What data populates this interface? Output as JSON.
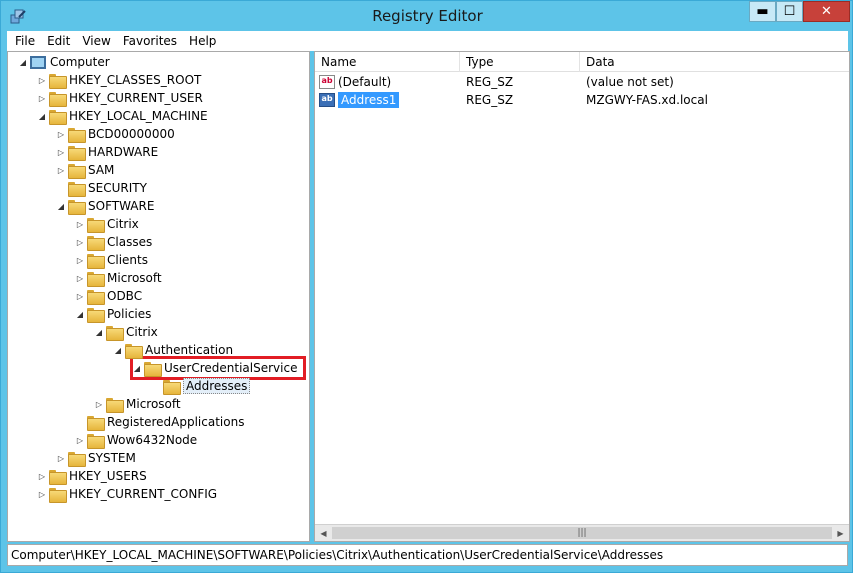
{
  "window": {
    "title": "Registry Editor",
    "controls": {
      "minimize": "▬",
      "maximize": "☐",
      "close": "✕"
    }
  },
  "menu": [
    "File",
    "Edit",
    "View",
    "Favorites",
    "Help"
  ],
  "tree": [
    {
      "label": "Computer",
      "depth": 0,
      "expander": "◢",
      "icon": "computer-icon"
    },
    {
      "label": "HKEY_CLASSES_ROOT",
      "depth": 1,
      "expander": "▷",
      "icon": "folder-icon"
    },
    {
      "label": "HKEY_CURRENT_USER",
      "depth": 1,
      "expander": "▷",
      "icon": "folder-icon"
    },
    {
      "label": "HKEY_LOCAL_MACHINE",
      "depth": 1,
      "expander": "◢",
      "icon": "folder-icon"
    },
    {
      "label": "BCD00000000",
      "depth": 2,
      "expander": "▷",
      "icon": "folder-icon"
    },
    {
      "label": "HARDWARE",
      "depth": 2,
      "expander": "▷",
      "icon": "folder-icon"
    },
    {
      "label": "SAM",
      "depth": 2,
      "expander": "▷",
      "icon": "folder-icon"
    },
    {
      "label": "SECURITY",
      "depth": 2,
      "expander": "",
      "icon": "folder-icon"
    },
    {
      "label": "SOFTWARE",
      "depth": 2,
      "expander": "◢",
      "icon": "folder-icon"
    },
    {
      "label": "Citrix",
      "depth": 3,
      "expander": "▷",
      "icon": "folder-icon"
    },
    {
      "label": "Classes",
      "depth": 3,
      "expander": "▷",
      "icon": "folder-icon"
    },
    {
      "label": "Clients",
      "depth": 3,
      "expander": "▷",
      "icon": "folder-icon"
    },
    {
      "label": "Microsoft",
      "depth": 3,
      "expander": "▷",
      "icon": "folder-icon"
    },
    {
      "label": "ODBC",
      "depth": 3,
      "expander": "▷",
      "icon": "folder-icon"
    },
    {
      "label": "Policies",
      "depth": 3,
      "expander": "◢",
      "icon": "folder-icon"
    },
    {
      "label": "Citrix",
      "depth": 4,
      "expander": "◢",
      "icon": "folder-icon"
    },
    {
      "label": "Authentication",
      "depth": 5,
      "expander": "◢",
      "icon": "folder-icon"
    },
    {
      "label": "UserCredentialService",
      "depth": 6,
      "expander": "◢",
      "icon": "folder-icon"
    },
    {
      "label": "Addresses",
      "depth": 7,
      "expander": "",
      "icon": "folder-icon",
      "selected": true
    },
    {
      "label": "Microsoft",
      "depth": 4,
      "expander": "▷",
      "icon": "folder-icon"
    },
    {
      "label": "RegisteredApplications",
      "depth": 3,
      "expander": "",
      "icon": "folder-icon"
    },
    {
      "label": "Wow6432Node",
      "depth": 3,
      "expander": "▷",
      "icon": "folder-icon"
    },
    {
      "label": "SYSTEM",
      "depth": 2,
      "expander": "▷",
      "icon": "folder-icon"
    },
    {
      "label": "HKEY_USERS",
      "depth": 1,
      "expander": "▷",
      "icon": "folder-icon"
    },
    {
      "label": "HKEY_CURRENT_CONFIG",
      "depth": 1,
      "expander": "▷",
      "icon": "folder-icon"
    }
  ],
  "list": {
    "columns": [
      "Name",
      "Type",
      "Data"
    ],
    "rows": [
      {
        "name": "(Default)",
        "type": "REG_SZ",
        "data": "(value not set)",
        "selected": false
      },
      {
        "name": "Address1",
        "type": "REG_SZ",
        "data": "MZGWY-FAS.xd.local",
        "selected": true
      }
    ]
  },
  "scrollbar": {
    "left_arrow": "◀",
    "right_arrow": "▶",
    "grip": "|||"
  },
  "status": "Computer\\HKEY_LOCAL_MACHINE\\SOFTWARE\\Policies\\Citrix\\Authentication\\UserCredentialService\\Addresses",
  "colors": {
    "highlight_box": "#e21d24",
    "selection": "#3399ff",
    "title_bg": "#5dc4e8"
  }
}
